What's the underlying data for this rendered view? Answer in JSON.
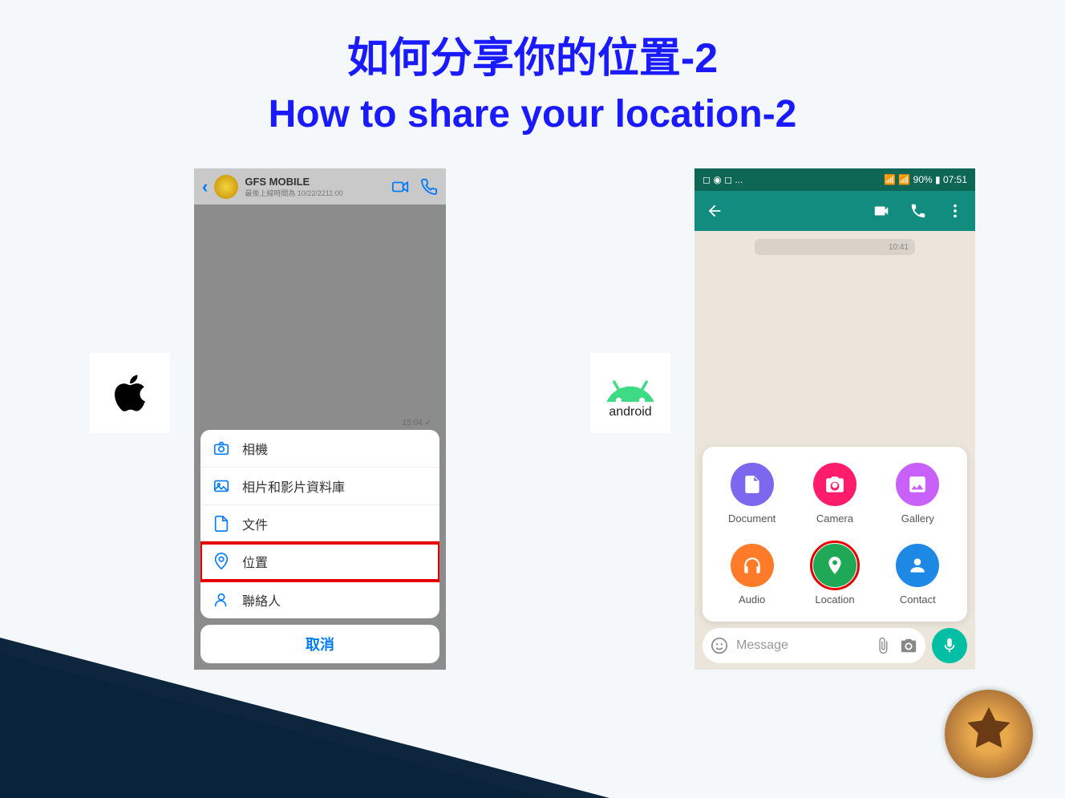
{
  "title_cn": "如何分享你的位置-2",
  "title_en": "How to share your location-2",
  "platforms": {
    "android_label": "android"
  },
  "iphone": {
    "contact_name": "GFS MOBILE",
    "contact_sub": "最後上線時間為 10/22/2211:00",
    "time_stamp": "15:04 ✓",
    "menu": {
      "camera": "相機",
      "gallery": "相片和影片資料庫",
      "document": "文件",
      "location": "位置",
      "contact": "聯絡人"
    },
    "cancel": "取消"
  },
  "android": {
    "status_left": "◻ ◉ ◻ ...",
    "status_right": "📶 📶 90% ▮ 07:51",
    "msg_time": "10:41",
    "attachments": {
      "document": "Document",
      "camera": "Camera",
      "gallery": "Gallery",
      "audio": "Audio",
      "location": "Location",
      "contact": "Contact"
    },
    "input_placeholder": "Message"
  },
  "colors": {
    "doc": "#7b68ee",
    "cam": "#ff1d6b",
    "gal": "#c861fa",
    "aud": "#ff7a29",
    "loc": "#1fa855",
    "con": "#1e88e5"
  }
}
